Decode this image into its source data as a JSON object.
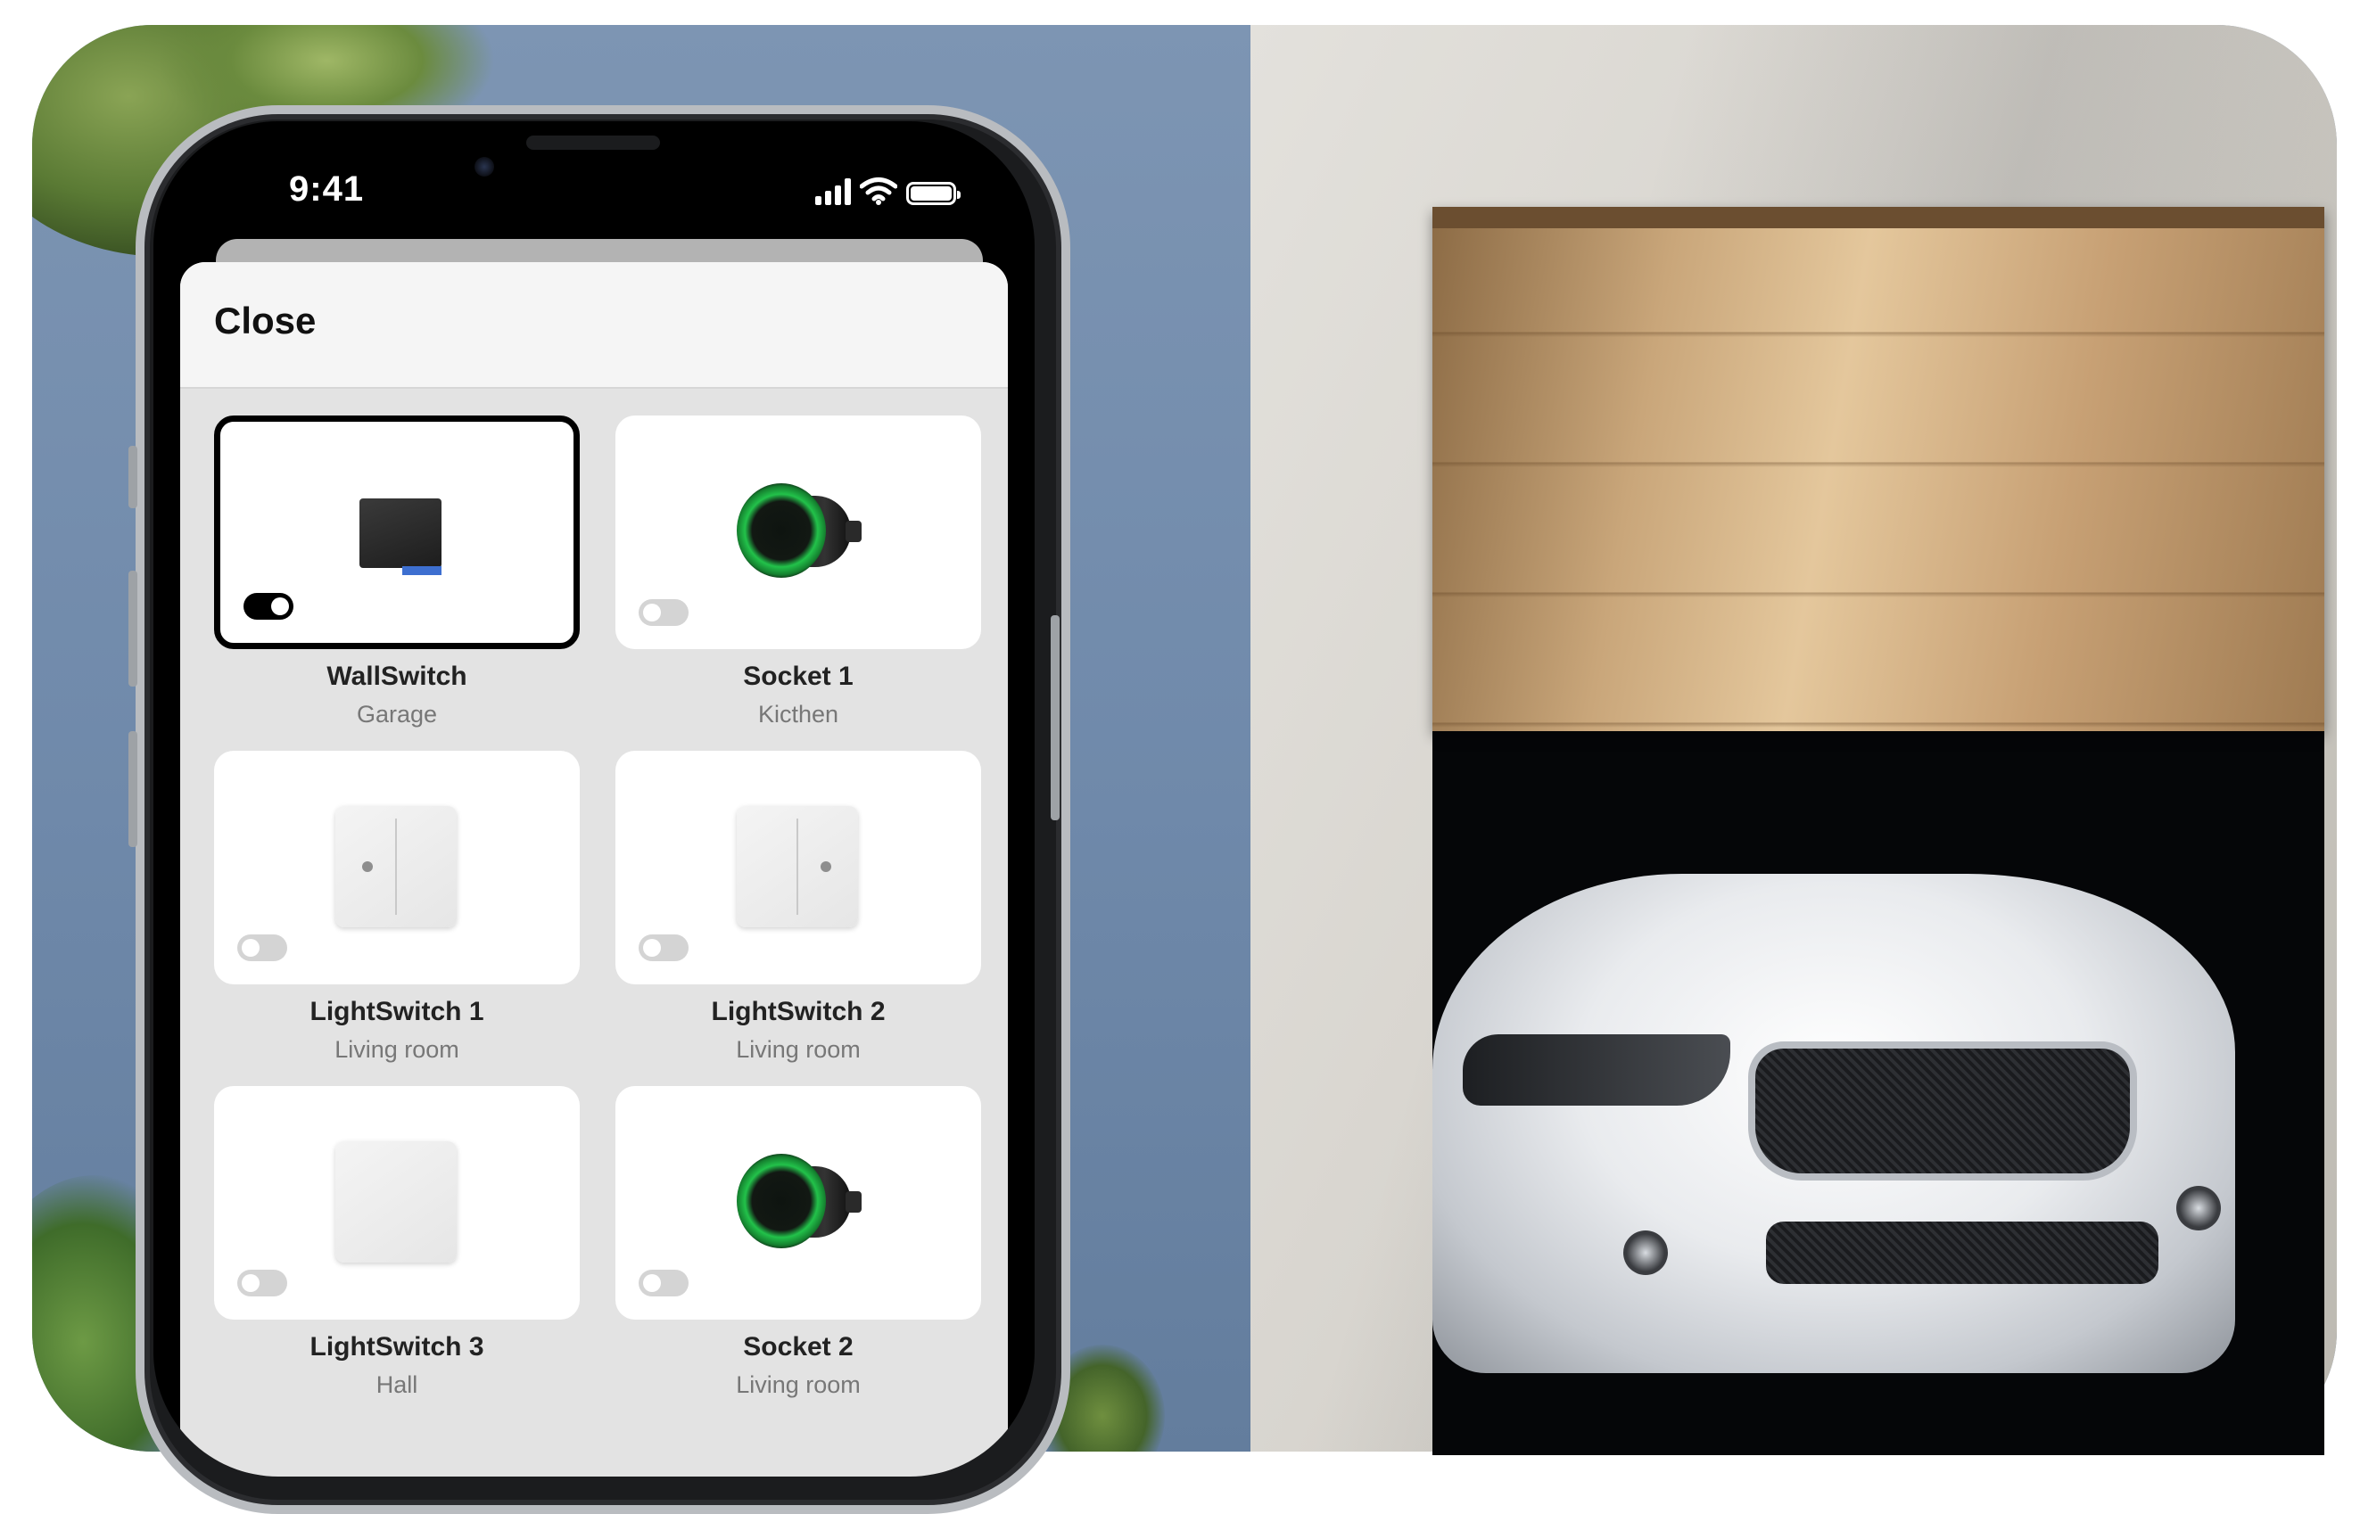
{
  "status_bar": {
    "time": "9:41"
  },
  "sheet": {
    "close_label": "Close"
  },
  "devices": [
    {
      "name": "WallSwitch",
      "room": "Garage",
      "enabled": true,
      "selected": true,
      "image": "wallswitch-relay"
    },
    {
      "name": "Socket 1",
      "room": "Kicthen",
      "enabled": false,
      "selected": false,
      "image": "smart-socket"
    },
    {
      "name": "LightSwitch 1",
      "room": "Living room",
      "enabled": false,
      "selected": false,
      "image": "lightswitch-two-gang-left"
    },
    {
      "name": "LightSwitch 2",
      "room": "Living room",
      "enabled": false,
      "selected": false,
      "image": "lightswitch-two-gang-right"
    },
    {
      "name": "LightSwitch 3",
      "room": "Hall",
      "enabled": false,
      "selected": false,
      "image": "lightswitch-one-gang"
    },
    {
      "name": "Socket 2",
      "room": "Living room",
      "enabled": false,
      "selected": false,
      "image": "smart-socket"
    }
  ],
  "colors": {
    "socket_ring": "#22c24a",
    "selected_border": "#000000",
    "toggle_on": "#000000",
    "toggle_off": "#d4d4d4"
  }
}
